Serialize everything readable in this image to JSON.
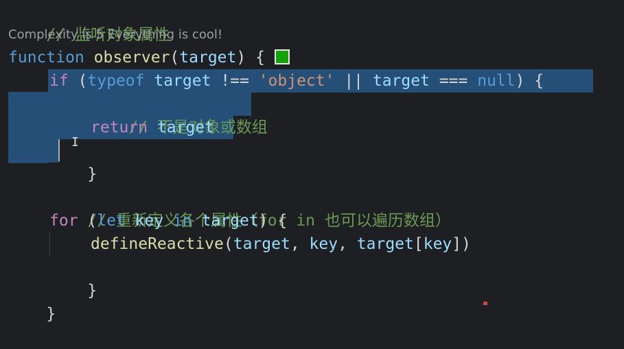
{
  "code": {
    "comment_observe": "// 监听对象属性",
    "codelens": "Complexity is 5 Everything is cool!",
    "l1": {
      "kw_function": "function",
      "fn_name": "observer",
      "open": "(",
      "param": "target",
      "close_brace": ") {"
    },
    "l2": {
      "kw_if": "if",
      "p1": " (",
      "kw_typeof": "typeof",
      "v1": " target",
      "op1": " !== ",
      "str": "'object'",
      "op2": " || ",
      "v2": "target",
      "op3": " === ",
      "kw_null": "null",
      "p2": ") {"
    },
    "l3_comment": "// 不是对象或数组",
    "l4": {
      "kw_return": "return",
      "var": " target"
    },
    "l5": "}",
    "l7_comment": "// 重新定义各个属性（for in 也可以遍历数组）",
    "l8": {
      "kw_for": "for",
      "p1": " (",
      "kw_let": "let",
      "v1": " key",
      "kw_in": " in",
      "v2": " target",
      "p2": ") {"
    },
    "l9": {
      "fn": "defineReactive",
      "p1": "(",
      "a1": "target",
      "c1": ", ",
      "a2": "key",
      "c2": ", ",
      "a3": "target",
      "b1": "[",
      "a4": "key",
      "b2": "])"
    },
    "l10": "}",
    "l11": "}"
  },
  "colors": {
    "background": "#1e1f22",
    "selection": "#264f78",
    "keyword": "#569cd6",
    "control": "#c586c0",
    "variable": "#9cdcfe",
    "function": "#dcdcaa",
    "string": "#ce9178",
    "comment": "#6a9955",
    "badge": "#13a10e"
  },
  "icons": {
    "status_badge": "green-square-icon",
    "cursor": "text-cursor-icon"
  }
}
